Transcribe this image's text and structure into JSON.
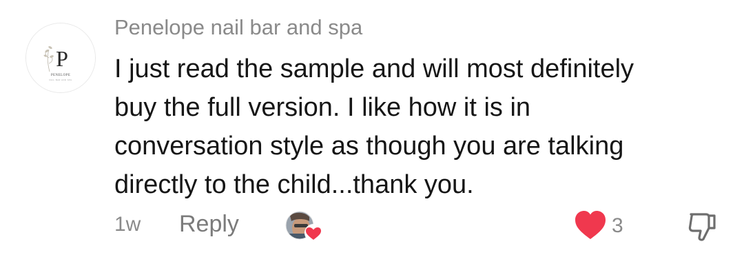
{
  "comment": {
    "username": "Penelope nail bar and spa",
    "avatar": {
      "monogram": "P",
      "brand_text": "PENELOPE",
      "tagline": "NAIL BAR AND SPA"
    },
    "text": "I just read the sample and will most definitely\nbuy the full version. I like how it is in\nconversation style as though you are talking\ndirectly to the child...thank you.",
    "timestamp": "1w",
    "reply_label": "Reply",
    "likes": "3",
    "icons": {
      "creator_liked": "creator-liked-heart-icon",
      "like": "heart-icon",
      "dislike": "thumbs-down-icon"
    }
  },
  "colors": {
    "heart": "#f0384e",
    "secondary_text": "#8a8a8a",
    "primary_text": "#161616"
  }
}
